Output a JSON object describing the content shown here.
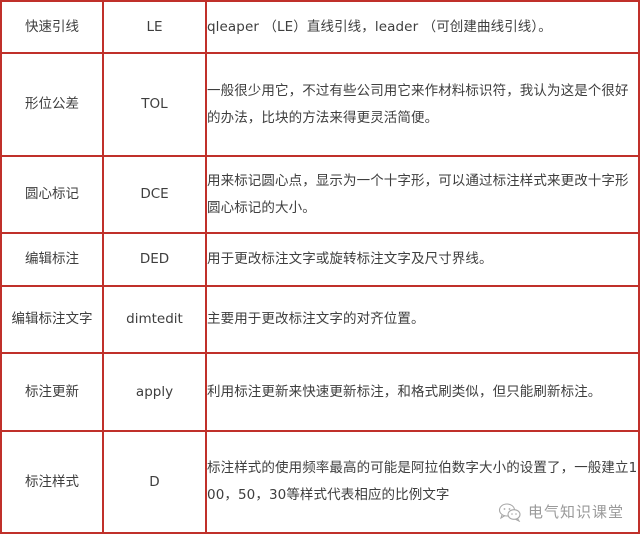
{
  "table": {
    "rows": [
      {
        "name": "快速引线",
        "command": "LE",
        "description": "qleaper （LE）直线引线，leader （可创建曲线引线）。"
      },
      {
        "name": "形位公差",
        "command": "TOL",
        "description": "一般很少用它，不过有些公司用它来作材料标识符，我认为这是个很好的办法，比块的方法来得更灵活简便。"
      },
      {
        "name": "圆心标记",
        "command": "DCE",
        "description": "用来标记圆心点，显示为一个十字形，可以通过标注样式来更改十字形圆心标记的大小。"
      },
      {
        "name": "编辑标注",
        "command": "DED",
        "description": "用于更改标注文字或旋转标注文字及尺寸界线。"
      },
      {
        "name": "编辑标注文字",
        "command": "dimtedit",
        "description": "主要用于更改标注文字的对齐位置。"
      },
      {
        "name": "标注更新",
        "command": "apply",
        "description": "利用标注更新来快速更新标注，和格式刷类似，但只能刷新标注。"
      },
      {
        "name": "标注样式",
        "command": "D",
        "description": "标注样式的使用频率最高的可能是阿拉伯数字大小的设置了，一般建立100，50，30等样式代表相应的比例文字"
      }
    ]
  },
  "watermark": {
    "icon": "wechat-icon",
    "text": "电气知识课堂"
  },
  "colors": {
    "border": "#c0302a",
    "text": "#3e3e3e",
    "watermark": "#9a9a9a"
  }
}
